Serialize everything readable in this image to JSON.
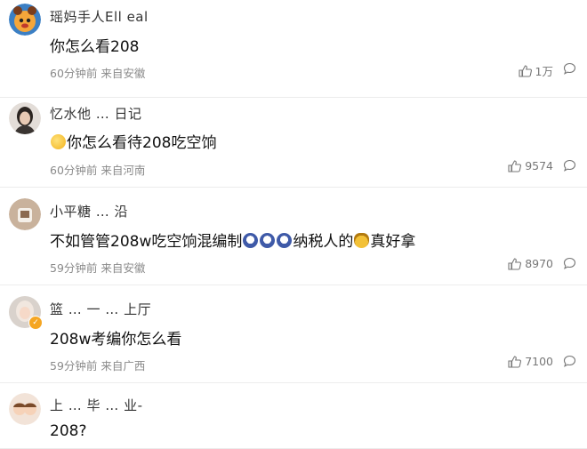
{
  "comments": [
    {
      "username": "瑶妈手人Ell  eal",
      "text": "你怎么看208",
      "time": "60分钟前",
      "location": "来自安徽",
      "likes": "1万",
      "avatar_color": "#f0a23a"
    },
    {
      "username": "忆水他 … 日记",
      "text": "你怎么看待208吃空饷",
      "time": "60分钟前",
      "location": "来自河南",
      "likes": "9574",
      "avatar_color": "#c9b9ad"
    },
    {
      "username": "小平糖 … 沿",
      "text_before": "不如管管208w吃空饷混编制",
      "text_after": "纳税人的",
      "text_end": "真好拿",
      "time": "59分钟前",
      "location": "来自安徽",
      "likes": "8970",
      "avatar_color": "#b69b86"
    },
    {
      "username": "篮 … 一 … 上厅",
      "text": "208w考编你怎么看",
      "time": "59分钟前",
      "location": "来自广西",
      "likes": "7100",
      "avatar_color": "#d8cfc8"
    },
    {
      "username": "上 … 毕 … 业-",
      "text": "208?",
      "avatar_color": "#e9c8b4"
    }
  ],
  "icons": {
    "like": "thumbs-up-icon",
    "reply": "comment-bubble-icon"
  }
}
